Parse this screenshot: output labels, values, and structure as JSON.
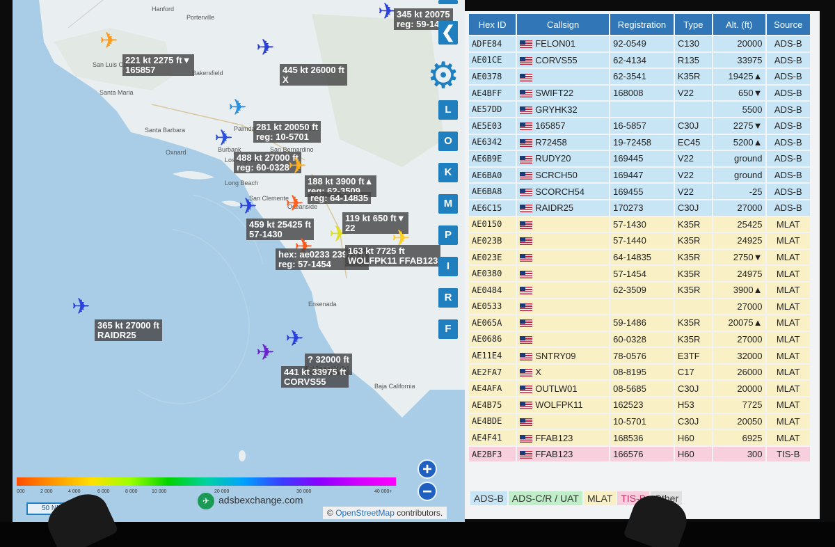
{
  "map": {
    "places": [
      "Hanford",
      "Porterville",
      "San Luis Obispo",
      "Bakersfield",
      "Santa Maria",
      "Santa Barbara",
      "Oxnard",
      "Palmdale",
      "Victorville",
      "Burbank",
      "San Bernardino",
      "Los Angeles",
      "Long Beach",
      "Oceanside",
      "San Clemente",
      "Ensenada",
      "Baja California"
    ],
    "aircraft": [
      {
        "icon": "airplane-icon",
        "color": "#ff9a1a",
        "line1": "221 kt  2275 ft▼",
        "line2": "165857"
      },
      {
        "icon": "airplane-icon",
        "color": "#2a3fd6",
        "line1": "445 kt  26000 ft",
        "line2": "X"
      },
      {
        "icon": "airplane-icon",
        "color": "#2a90e0",
        "line1": "281 kt  20050 ft",
        "line2": "reg: 10-5701"
      },
      {
        "icon": "airplane-icon",
        "color": "#2a50e0",
        "line1": "488 kt  27000 ft",
        "line2": "reg: 60-0328"
      },
      {
        "icon": "airplane-icon",
        "color": "#ffb020",
        "line1": "188 kt  3900 ft▲",
        "line2": "reg: 62-3509"
      },
      {
        "icon": "airplane-icon",
        "color": "#ff6020",
        "line1": "reg: 64-14835",
        "line2": ""
      },
      {
        "icon": "airplane-icon",
        "color": "#2a40e0",
        "line1": "459 kt  25425 ft",
        "line2": "57-1430"
      },
      {
        "icon": "airplane-icon",
        "color": "#ff5a20",
        "line1": "hex: ae0233  23975 ft",
        "line2": "reg: 57-1454"
      },
      {
        "icon": "airplane-icon",
        "color": "#e0e020",
        "line1": "119 kt  650 ft▼",
        "line2": "22"
      },
      {
        "icon": "airplane-icon",
        "color": "#ffd020",
        "line1": "163 kt  7725 ft",
        "line2": "WOLFPK11  FFAB123"
      },
      {
        "icon": "airplane-icon",
        "color": "#2a40e0",
        "line1": "365 kt  27000 ft",
        "line2": "RAIDR25"
      },
      {
        "icon": "airplane-icon",
        "color": "#2a40e0",
        "line1": "?  32000 ft",
        "line2": "SNTRY09"
      },
      {
        "icon": "airplane-icon",
        "color": "#6a20d0",
        "line1": "441 kt  33975 ft",
        "line2": "CORVS55"
      },
      {
        "icon": "airplane-icon",
        "color": "#2a40e0",
        "line1": "345 kt  20075",
        "line2": "reg: 59-1486"
      }
    ],
    "sidebar_buttons": [
      "L",
      "O",
      "K",
      "M",
      "P",
      "I",
      "R",
      "F"
    ],
    "alt_ticks": [
      "000",
      "2 000",
      "4 000",
      "6 000",
      "8 000",
      "10 000",
      "20 000",
      "30 000",
      "40 000+"
    ],
    "scale": "50 NM",
    "brand": "adsbexchange.com",
    "attribution_link": "OpenStreetMap",
    "attribution_rest": " contributors."
  },
  "table": {
    "headers": [
      "Hex ID",
      "Callsign",
      "Registration",
      "Type",
      "Alt. (ft)",
      "Source"
    ],
    "rows": [
      {
        "hex": "ADFE84",
        "callsign": "FELON01",
        "reg": "92-0549",
        "type": "C130",
        "alt": "20000",
        "src": "ADS-B",
        "cls": "adsb"
      },
      {
        "hex": "AE01CE",
        "callsign": "CORVS55",
        "reg": "62-4134",
        "type": "R135",
        "alt": "33975",
        "src": "ADS-B",
        "cls": "adsb"
      },
      {
        "hex": "AE0378",
        "callsign": "",
        "reg": "62-3541",
        "type": "K35R",
        "alt": "19425▲",
        "src": "ADS-B",
        "cls": "adsb"
      },
      {
        "hex": "AE4BFF",
        "callsign": "SWIFT22",
        "reg": "168008",
        "type": "V22",
        "alt": "650▼",
        "src": "ADS-B",
        "cls": "adsb"
      },
      {
        "hex": "AE57DD",
        "callsign": "GRYHK32",
        "reg": "",
        "type": "",
        "alt": "5500",
        "src": "ADS-B",
        "cls": "adsb"
      },
      {
        "hex": "AE5E03",
        "callsign": "165857",
        "reg": "16-5857",
        "type": "C30J",
        "alt": "2275▼",
        "src": "ADS-B",
        "cls": "adsb"
      },
      {
        "hex": "AE6342",
        "callsign": "R72458",
        "reg": "19-72458",
        "type": "EC45",
        "alt": "5200▲",
        "src": "ADS-B",
        "cls": "adsb"
      },
      {
        "hex": "AE6B9E",
        "callsign": "RUDY20",
        "reg": "169445",
        "type": "V22",
        "alt": "ground",
        "src": "ADS-B",
        "cls": "adsb"
      },
      {
        "hex": "AE6BA0",
        "callsign": "SCRCH50",
        "reg": "169447",
        "type": "V22",
        "alt": "ground",
        "src": "ADS-B",
        "cls": "adsb"
      },
      {
        "hex": "AE6BA8",
        "callsign": "SCORCH54",
        "reg": "169455",
        "type": "V22",
        "alt": "-25",
        "src": "ADS-B",
        "cls": "adsb"
      },
      {
        "hex": "AE6C15",
        "callsign": "RAIDR25",
        "reg": "170273",
        "type": "C30J",
        "alt": "27000",
        "src": "ADS-B",
        "cls": "adsb"
      },
      {
        "hex": "AE0150",
        "callsign": "",
        "reg": "57-1430",
        "type": "K35R",
        "alt": "25425",
        "src": "MLAT",
        "cls": "mlat"
      },
      {
        "hex": "AE023B",
        "callsign": "",
        "reg": "57-1440",
        "type": "K35R",
        "alt": "24925",
        "src": "MLAT",
        "cls": "mlat"
      },
      {
        "hex": "AE023E",
        "callsign": "",
        "reg": "64-14835",
        "type": "K35R",
        "alt": "2750▼",
        "src": "MLAT",
        "cls": "mlat"
      },
      {
        "hex": "AE0380",
        "callsign": "",
        "reg": "57-1454",
        "type": "K35R",
        "alt": "24975",
        "src": "MLAT",
        "cls": "mlat"
      },
      {
        "hex": "AE0484",
        "callsign": "",
        "reg": "62-3509",
        "type": "K35R",
        "alt": "3900▲",
        "src": "MLAT",
        "cls": "mlat"
      },
      {
        "hex": "AE0533",
        "callsign": "",
        "reg": "",
        "type": "",
        "alt": "27000",
        "src": "MLAT",
        "cls": "mlat"
      },
      {
        "hex": "AE065A",
        "callsign": "",
        "reg": "59-1486",
        "type": "K35R",
        "alt": "20075▲",
        "src": "MLAT",
        "cls": "mlat"
      },
      {
        "hex": "AE0686",
        "callsign": "",
        "reg": "60-0328",
        "type": "K35R",
        "alt": "27000",
        "src": "MLAT",
        "cls": "mlat"
      },
      {
        "hex": "AE11E4",
        "callsign": "SNTRY09",
        "reg": "78-0576",
        "type": "E3TF",
        "alt": "32000",
        "src": "MLAT",
        "cls": "mlat"
      },
      {
        "hex": "AE2FA7",
        "callsign": "X",
        "reg": "08-8195",
        "type": "C17",
        "alt": "26000",
        "src": "MLAT",
        "cls": "mlat"
      },
      {
        "hex": "AE4AFA",
        "callsign": "OUTLW01",
        "reg": "08-5685",
        "type": "C30J",
        "alt": "20000",
        "src": "MLAT",
        "cls": "mlat"
      },
      {
        "hex": "AE4B75",
        "callsign": "WOLFPK11",
        "reg": "162523",
        "type": "H53",
        "alt": "7725",
        "src": "MLAT",
        "cls": "mlat"
      },
      {
        "hex": "AE4BDE",
        "callsign": "",
        "reg": "10-5701",
        "type": "C30J",
        "alt": "20050",
        "src": "MLAT",
        "cls": "mlat"
      },
      {
        "hex": "AE4F41",
        "callsign": "FFAB123",
        "reg": "168536",
        "type": "H60",
        "alt": "6925",
        "src": "MLAT",
        "cls": "mlat"
      },
      {
        "hex": "AE2BF3",
        "callsign": "FFAB123",
        "reg": "166576",
        "type": "H60",
        "alt": "300",
        "src": "TIS-B",
        "cls": "tisb"
      }
    ]
  },
  "legend": [
    {
      "label": "ADS-B",
      "color": "#c8e5f6",
      "text": "#333"
    },
    {
      "label": "ADS-C/R / UAT",
      "color": "#bfeec8",
      "text": "#333"
    },
    {
      "label": "MLAT",
      "color": "#faf0c6",
      "text": "#333"
    },
    {
      "label": "TIS-B",
      "color": "#f7cfdd",
      "text": "#c0306a"
    },
    {
      "label": "Other",
      "color": "#e0e0e0",
      "text": "#333"
    }
  ],
  "colors": {
    "accent": "#1f7fbf",
    "header": "#3176b6"
  }
}
